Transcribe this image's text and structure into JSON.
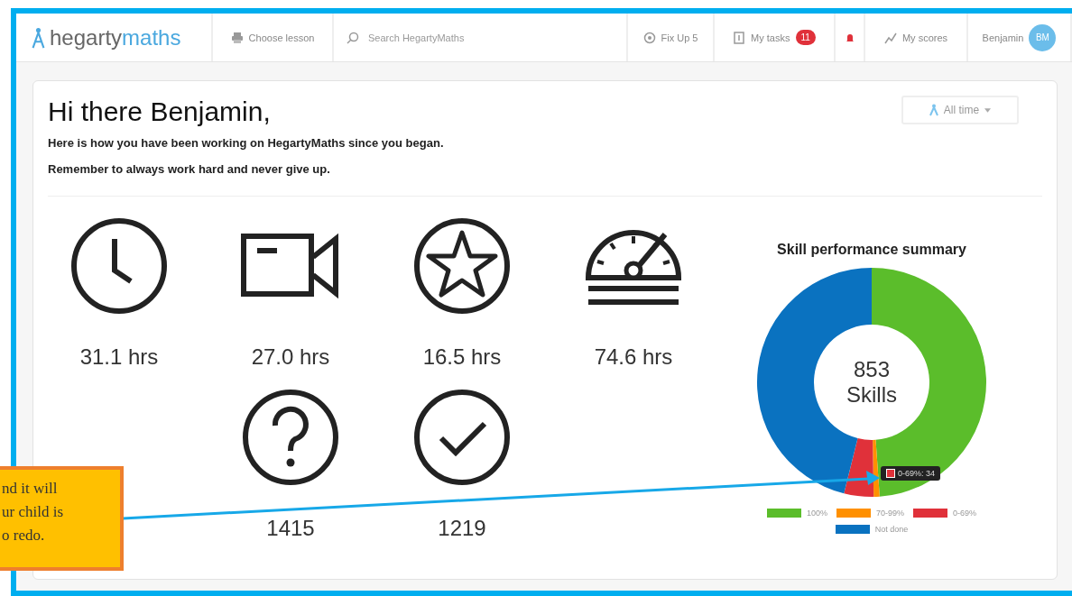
{
  "nav": {
    "logo_left": "hegarty",
    "logo_right": "maths",
    "choose_lesson": "Choose lesson",
    "search": {
      "placeholder": "Search HegartyMaths"
    },
    "fix_up": "Fix Up 5",
    "tasks": "My tasks",
    "tasks_badge": "11",
    "scores": "My scores",
    "user": "Benjamin",
    "avatar": "BM"
  },
  "greeting": {
    "title": "Hi there Benjamin,",
    "lines": [
      "Here is how you have been working on HegartyMaths since you began.",
      "Remember to always work hard and never give up."
    ]
  },
  "filter": {
    "label": "All time"
  },
  "stats": [
    {
      "kind": "clock",
      "value": "31.1 hrs"
    },
    {
      "kind": "video",
      "value": "27.0 hrs"
    },
    {
      "kind": "star",
      "value": "16.5 hrs"
    },
    {
      "kind": "speedometer",
      "value": "74.6 hrs"
    },
    {
      "kind": "question",
      "value": "1415"
    },
    {
      "kind": "check",
      "value": "1219"
    }
  ],
  "summary": {
    "title": "Skill performance summary",
    "total": "853",
    "unit": "Skills",
    "tooltip": "0-69%: 34",
    "legend": [
      {
        "label": "100%",
        "color": "#5bbd2b"
      },
      {
        "label": "70-99%",
        "color": "#ff9000"
      },
      {
        "label": "0-69%",
        "color": "#e0313a"
      },
      {
        "label": "Not done",
        "color": "#0a72c0"
      }
    ]
  },
  "callout": {
    "lines": [
      "nd it will",
      "ur child is",
      "o redo."
    ]
  }
}
